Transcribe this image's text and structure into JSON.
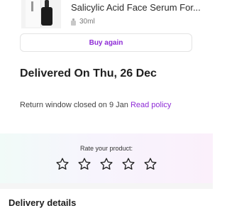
{
  "product": {
    "name": "Salicylic Acid Face Serum For...",
    "volume": "30ml"
  },
  "actions": {
    "buy_again_label": "Buy again"
  },
  "delivery": {
    "status_title": "Delivered On Thu, 26 Dec",
    "return_text": "Return window closed on 9 Jan",
    "read_policy_label": "Read policy"
  },
  "rating": {
    "prompt": "Rate your product:",
    "max_stars": 5,
    "selected": 0
  },
  "details": {
    "heading": "Delivery details"
  },
  "colors": {
    "accent": "#8e2bd6"
  }
}
